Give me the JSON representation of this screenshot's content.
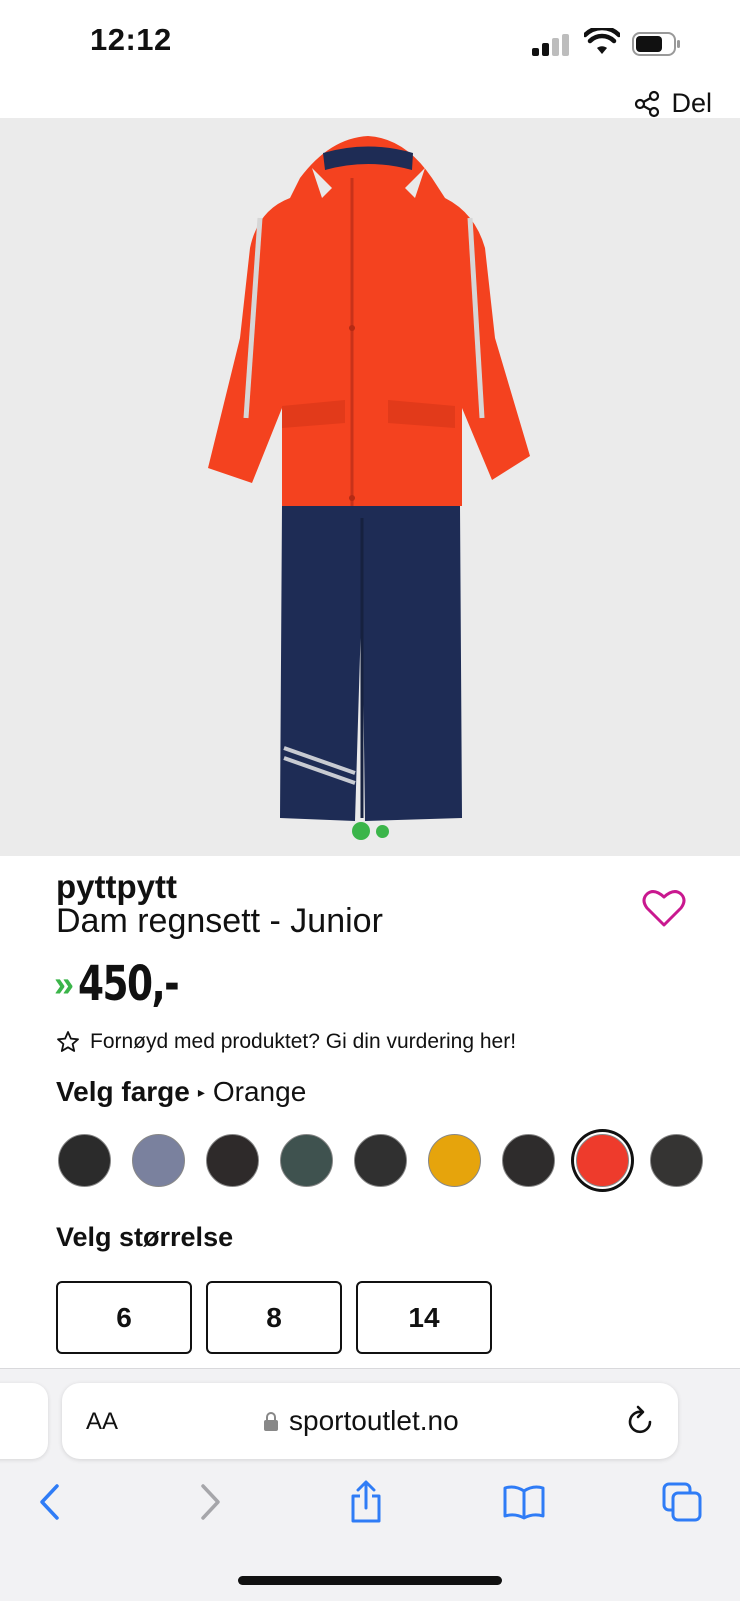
{
  "status_bar": {
    "time": "12:12"
  },
  "share": {
    "label": "Del"
  },
  "product": {
    "brand": "pyttpytt",
    "name": "Dam regnsett - Junior",
    "price": "450,-",
    "rating_prompt": "Fornøyd med produktet? Gi din vurdering her!"
  },
  "color": {
    "label": "Velg farge",
    "selected": "Orange",
    "swatches": [
      "#2b2b2b",
      "#7a819e",
      "#2e2a2a",
      "#3f524f",
      "#303030",
      "#e6a40c",
      "#2e2c2c",
      "#ee3b2c",
      "#353433"
    ],
    "selected_index": 7
  },
  "size": {
    "label": "Velg størrelse",
    "options": [
      "6",
      "8",
      "14"
    ]
  },
  "browser": {
    "aa_label": "AA",
    "url": "sportoutlet.no"
  },
  "colors": {
    "accent_green": "#3bb54a",
    "heart_pink": "#c9188f",
    "ios_blue": "#2f7cf6"
  }
}
